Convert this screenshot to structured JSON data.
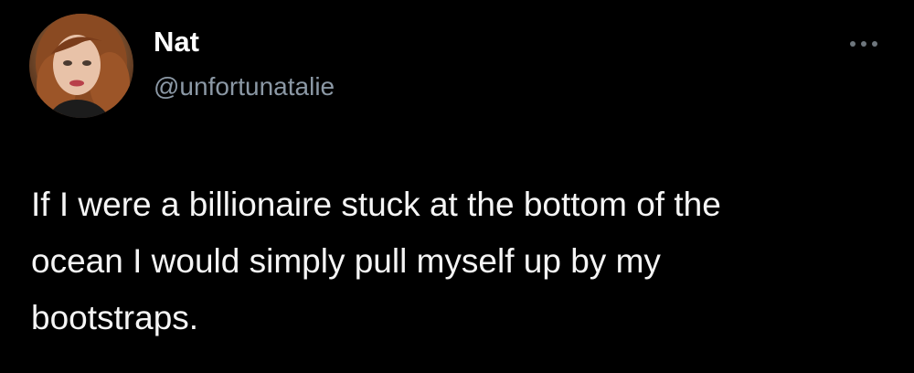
{
  "author": {
    "display_name": "Nat",
    "handle": "@unfortunatalie",
    "avatar_icon": "profile-photo"
  },
  "actions": {
    "more_icon": "more-horizontal-icon"
  },
  "tweet": {
    "text": "If I were a billionaire stuck at the bottom of the\nocean I would simply pull myself up by my\nbootstraps."
  },
  "colors": {
    "background": "#000000",
    "name": "#ffffff",
    "handle": "#8b98a5",
    "body_text": "#f5f5f5",
    "more_icon": "#6e767d"
  }
}
